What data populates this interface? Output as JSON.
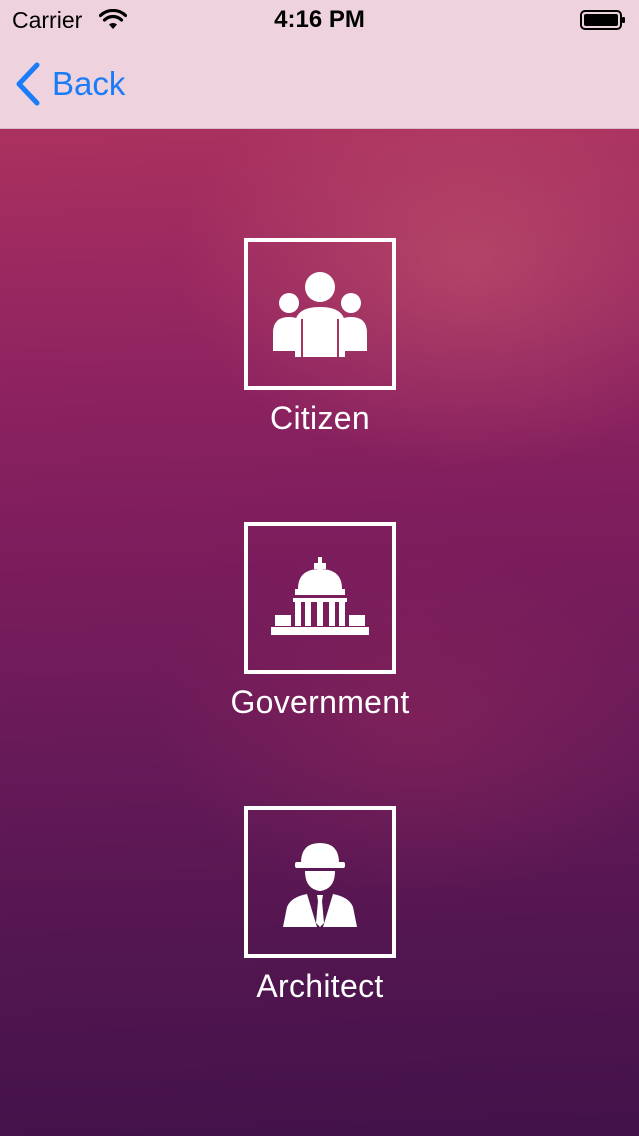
{
  "status_bar": {
    "carrier": "Carrier",
    "time": "4:16 PM",
    "wifi_icon": "wifi-icon",
    "battery_icon": "battery-icon"
  },
  "nav": {
    "back_label": "Back",
    "back_icon": "chevron-left-icon"
  },
  "roles": [
    {
      "label": "Citizen",
      "icon": "people-group-icon"
    },
    {
      "label": "Government",
      "icon": "capitol-building-icon"
    },
    {
      "label": "Architect",
      "icon": "engineer-hardhat-icon"
    }
  ],
  "colors": {
    "accent": "#1a7cf7",
    "nav_background": "#eed3df",
    "gradient_top": "#b8395f",
    "gradient_bottom": "#43124a",
    "foreground": "#ffffff"
  }
}
